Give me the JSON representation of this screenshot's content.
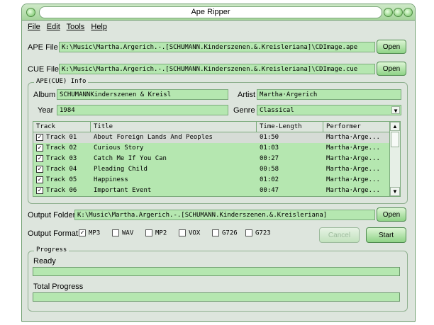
{
  "window": {
    "title": "Ape Ripper"
  },
  "menu": [
    "File",
    "Edit",
    "Tools",
    "Help"
  ],
  "ape_file": {
    "label": "APE File",
    "value": "K:\\Music\\Martha.Argerich.-.[SCHUMANN.Kinderszenen.&.Kreisleriana]\\CDImage.ape",
    "button": "Open"
  },
  "cue_file": {
    "label": "CUE File",
    "value": "K:\\Music\\Martha.Argerich.-.[SCHUMANN.Kinderszenen.&.Kreisleriana]\\CDImage.cue",
    "button": "Open"
  },
  "info": {
    "group_title": "APE(CUE) Info",
    "album_label": "Album",
    "album": "SCHUMANNKinderszenen & Kreisl",
    "artist_label": "Artist",
    "artist": "Martha·Argerich",
    "year_label": "Year",
    "year": "1984",
    "genre_label": "Genre",
    "genre": "Classical"
  },
  "tracks": {
    "columns": [
      "Track",
      "Title",
      "Time-Length",
      "Performer"
    ],
    "rows": [
      {
        "track": "Track 01",
        "title": "About Foreign Lands And Peoples",
        "time": "01:50",
        "performer": "Martha·Arge...",
        "checked": true
      },
      {
        "track": "Track 02",
        "title": "Curious Story",
        "time": "01:03",
        "performer": "Martha·Arge...",
        "checked": true
      },
      {
        "track": "Track 03",
        "title": "Catch Me If You Can",
        "time": "00:27",
        "performer": "Martha·Arge...",
        "checked": true
      },
      {
        "track": "Track 04",
        "title": "Pleading Child",
        "time": "00:58",
        "performer": "Martha·Arge...",
        "checked": true
      },
      {
        "track": "Track 05",
        "title": "Happiness",
        "time": "01:02",
        "performer": "Martha·Arge...",
        "checked": true
      },
      {
        "track": "Track 06",
        "title": "Important Event",
        "time": "00:47",
        "performer": "Martha·Arge...",
        "checked": true
      }
    ]
  },
  "output_folder": {
    "label": "Output Folder",
    "value": "K:\\Music\\Martha.Argerich.-.[SCHUMANN.Kinderszenen.&.Kreisleriana]",
    "button": "Open"
  },
  "output_format": {
    "label": "Output Format:",
    "options": [
      {
        "name": "MP3",
        "checked": true
      },
      {
        "name": "WAV",
        "checked": false
      },
      {
        "name": "MP2",
        "checked": false
      },
      {
        "name": "VOX",
        "checked": false
      },
      {
        "name": "G726",
        "checked": false
      },
      {
        "name": "G723",
        "checked": false
      }
    ],
    "cancel": "Cancel",
    "start": "Start"
  },
  "progress": {
    "group_title": "Progress",
    "status": "Ready",
    "status_fraction": 0,
    "total_label": "Total Progress",
    "total_fraction": 0
  }
}
